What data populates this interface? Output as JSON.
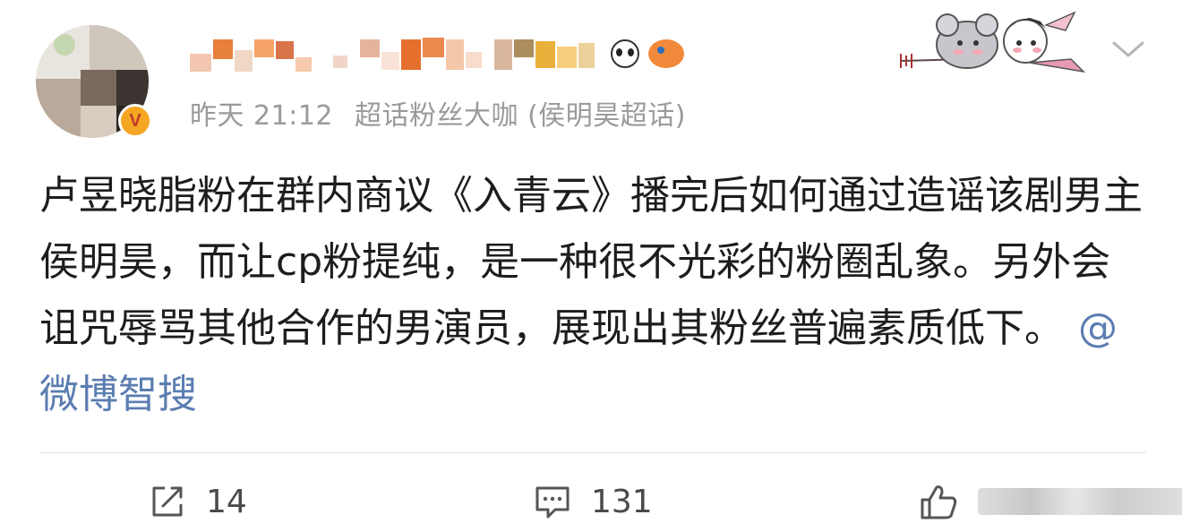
{
  "header": {
    "timestamp": "昨天 21:12",
    "badge_text": "超话粉丝大咖 (侯明昊超话)",
    "verified_mark": "V"
  },
  "post": {
    "text": "卢昱晓脂粉在群内商议《入青云》播完后如何通过造谣该剧男主侯明昊，而让cp粉提纯，是一种很不光彩的粉圈乱象。另外会诅咒辱骂其他合作的男演员，展现出其粉丝普遍素质低下。",
    "mention": "@微博智搜"
  },
  "actions": {
    "repost_count": "14",
    "comment_count": "131"
  },
  "colors": {
    "mention": "#5b7db1",
    "meta_text": "#9a9a9a",
    "verified_badge": "#f5a623",
    "icon": "#555555"
  },
  "icons": {
    "repost": "share-icon",
    "comment": "comment-icon",
    "like": "thumb-up-icon",
    "menu": "chevron-down-icon"
  }
}
